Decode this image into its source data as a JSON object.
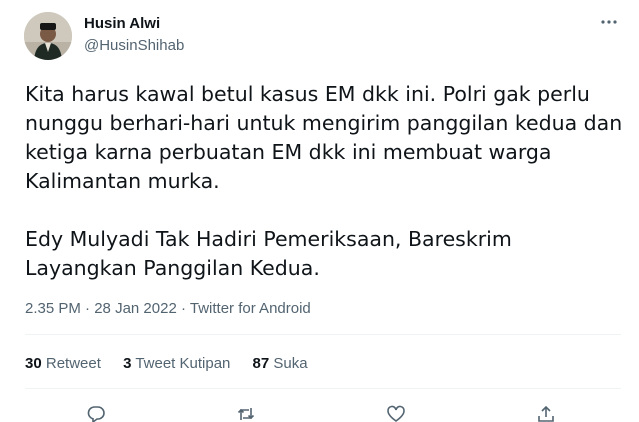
{
  "author": {
    "name": "Husin Alwi",
    "handle": "@HusinShihab"
  },
  "more_icon": "more-horizontal-icon",
  "tweet": {
    "paragraph_1": "Kita harus kawal betul kasus EM dkk ini. Polri gak perlu nunggu berhari-hari untuk mengirim panggilan kedua dan ketiga karna perbuatan EM dkk ini membuat warga Kalimantan murka.",
    "paragraph_2": "Edy Mulyadi Tak Hadiri Pemeriksaan, Bareskrim Layangkan Panggilan Kedua."
  },
  "meta": {
    "time": "2.35 PM",
    "separator": "·",
    "date": "28 Jan 2022",
    "source": "Twitter for Android"
  },
  "stats": {
    "retweets_count": "30",
    "retweets_label": "Retweet",
    "quotes_count": "3",
    "quotes_label": "Tweet Kutipan",
    "likes_count": "87",
    "likes_label": "Suka"
  },
  "actions": [
    "reply-icon",
    "retweet-icon",
    "like-icon",
    "share-icon"
  ],
  "colors": {
    "text_primary": "#0f1419",
    "text_secondary": "#536471",
    "divider": "#eff3f4"
  }
}
